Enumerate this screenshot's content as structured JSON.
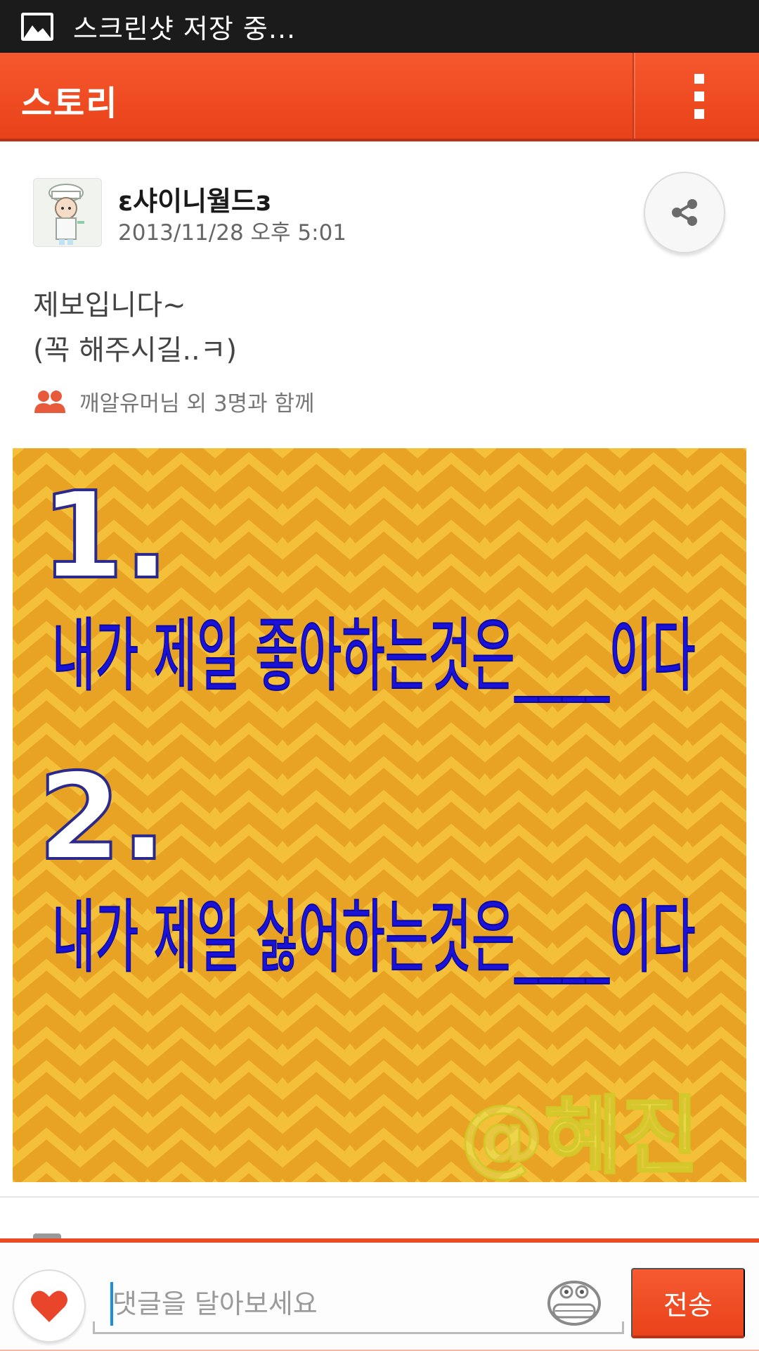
{
  "status_bar": {
    "notification_icon": "picture-icon",
    "text": "스크린샷 저장 중..."
  },
  "action_bar": {
    "title": "스토리",
    "menu_icon": "overflow-menu-icon"
  },
  "post": {
    "author": "ε샤이니월드з",
    "time": "2013/11/28 오후 5:01",
    "body_line1": "제보입니다~",
    "body_line2": "(꼭 해주시길..ㅋ)",
    "with_friends": "깨알유머님 외 3명과 함께",
    "image": {
      "num1": "1.",
      "line1": "내가 제일 좋아하는것은____이다",
      "num2": "2.",
      "line2": "내가 제일 싫어하는것은____이다",
      "watermark": "@혜진"
    }
  },
  "comment_bar": {
    "placeholder": "댓글을 달아보세요",
    "send_label": "전송"
  },
  "colors": {
    "accent": "#f04d22",
    "image_background": "#f2b41d",
    "image_text": "#1a12d8"
  }
}
